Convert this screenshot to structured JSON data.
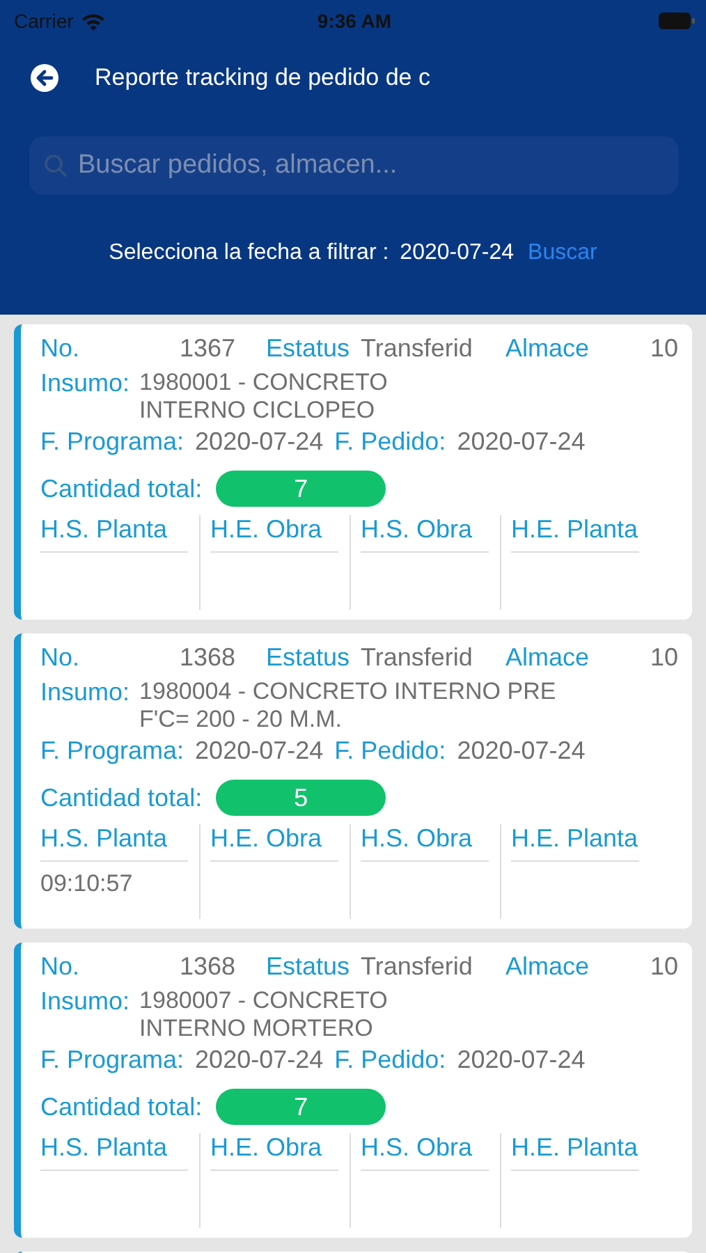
{
  "status_bar": {
    "carrier": "Carrier",
    "time": "9:36 AM"
  },
  "header": {
    "title": "Reporte tracking de pedido de c"
  },
  "search": {
    "placeholder": "Buscar pedidos, almacen..."
  },
  "filter": {
    "label": "Selecciona la fecha a filtrar :",
    "date": "2020-07-24",
    "button": "Buscar"
  },
  "orders": [
    {
      "no_label": "No.",
      "no": "1367",
      "status_label": "Estatus",
      "status": "Transferid",
      "warehouse_label": "Almace",
      "warehouse": "10",
      "supply_label": "Insumo:",
      "supply": "1980001 - CONCRETO\nINTERNO CICLOPEO",
      "program_label": "F. Programa:",
      "program_date": "2020-07-24",
      "order_label": "F. Pedido:",
      "order_date": "2020-07-24",
      "quantity_label": "Cantidad total:",
      "quantity": "7",
      "times": [
        {
          "label": "H.S. Planta"
        },
        {
          "label": "H.E. Obra"
        },
        {
          "label": "H.S. Obra"
        },
        {
          "label": "H.E. Planta"
        }
      ]
    },
    {
      "no_label": "No.",
      "no": "1368",
      "status_label": "Estatus",
      "status": "Transferid",
      "warehouse_label": "Almace",
      "warehouse": "10",
      "supply_label": "Insumo:",
      "supply": "1980004 - CONCRETO INTERNO PRE\nF'C= 200 - 20 M.M.",
      "program_label": "F. Programa:",
      "program_date": "2020-07-24",
      "order_label": "F. Pedido:",
      "order_date": "2020-07-24",
      "quantity_label": "Cantidad total:",
      "quantity": "5",
      "times": [
        {
          "label": "H.S. Planta",
          "value": "09:10:57"
        },
        {
          "label": "H.E. Obra"
        },
        {
          "label": "H.S. Obra"
        },
        {
          "label": "H.E. Planta"
        }
      ]
    },
    {
      "no_label": "No.",
      "no": "1368",
      "status_label": "Estatus",
      "status": "Transferid",
      "warehouse_label": "Almace",
      "warehouse": "10",
      "supply_label": "Insumo:",
      "supply": "1980007 - CONCRETO\nINTERNO MORTERO",
      "program_label": "F. Programa:",
      "program_date": "2020-07-24",
      "order_label": "F. Pedido:",
      "order_date": "2020-07-24",
      "quantity_label": "Cantidad total:",
      "quantity": "7",
      "times": [
        {
          "label": "H.S. Planta"
        },
        {
          "label": "H.E. Obra"
        },
        {
          "label": "H.S. Obra"
        },
        {
          "label": "H.E. Planta"
        }
      ]
    }
  ]
}
